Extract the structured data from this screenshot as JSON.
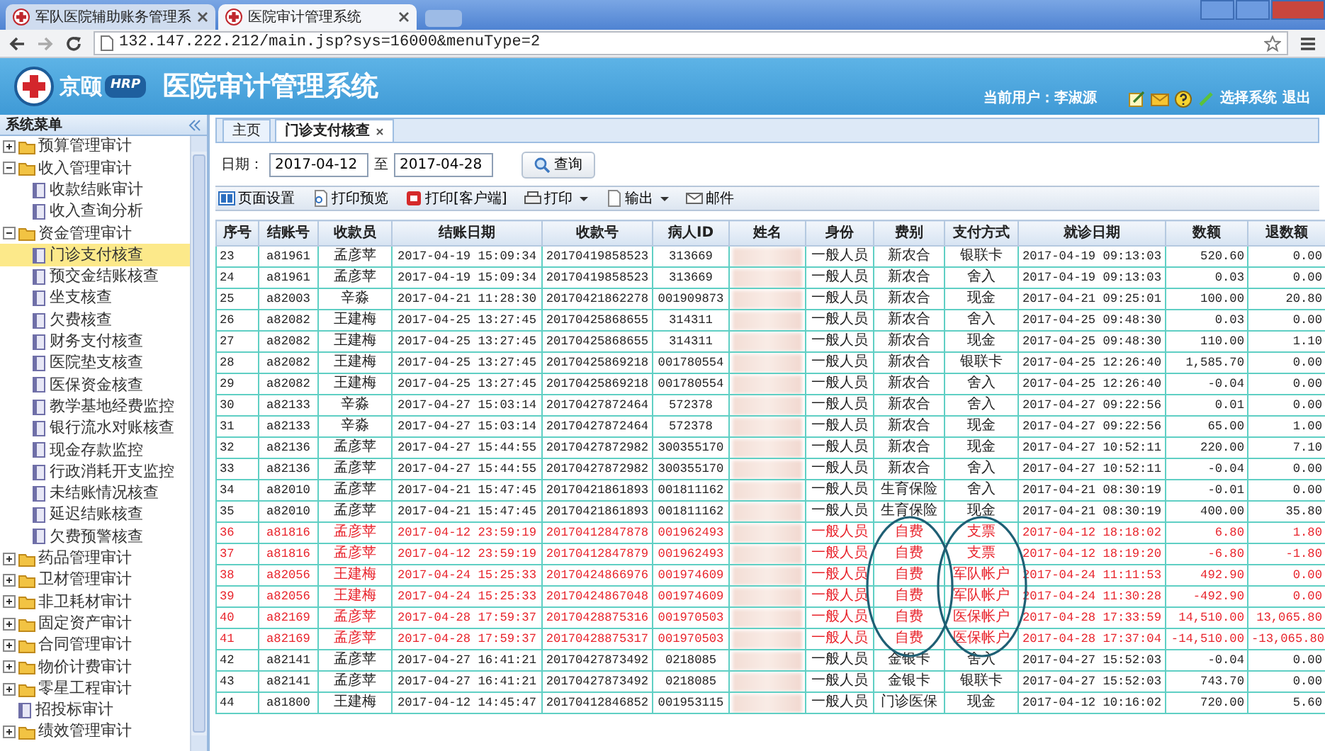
{
  "browser": {
    "tabs": [
      {
        "title": "军队医院辅助账务管理系",
        "selected": false
      },
      {
        "title": "医院审计管理系统",
        "selected": true
      }
    ],
    "url": "132.147.222.212/main.jsp?sys=16000&menuType=2"
  },
  "header": {
    "brand": "京颐",
    "brand_badge": "HRP",
    "title": "医院审计管理系统",
    "user_label": "当前用户：",
    "user_name": "李淑源",
    "links": [
      "选择系统",
      "退出"
    ]
  },
  "sidebar": {
    "title": "系统菜单",
    "items": [
      {
        "kind": "group",
        "label": "预算管理审计",
        "expanded": false
      },
      {
        "kind": "group",
        "label": "收入管理审计",
        "expanded": true,
        "children": [
          {
            "label": "收款结账审计",
            "selected": false
          },
          {
            "label": "收入查询分析",
            "selected": false
          }
        ]
      },
      {
        "kind": "group",
        "label": "资金管理审计",
        "expanded": true,
        "children": [
          {
            "label": "门诊支付核查",
            "selected": true
          },
          {
            "label": "预交金结账核查",
            "selected": false
          },
          {
            "label": "坐支核查",
            "selected": false
          },
          {
            "label": "欠费核查",
            "selected": false
          },
          {
            "label": "财务支付核查",
            "selected": false
          },
          {
            "label": "医院垫支核查",
            "selected": false
          },
          {
            "label": "医保资金核查",
            "selected": false
          },
          {
            "label": "教学基地经费监控",
            "selected": false
          },
          {
            "label": "银行流水对账核查",
            "selected": false
          },
          {
            "label": "现金存款监控",
            "selected": false
          },
          {
            "label": "行政消耗开支监控",
            "selected": false
          },
          {
            "label": "未结账情况核查",
            "selected": false
          },
          {
            "label": "延迟结账核查",
            "selected": false
          },
          {
            "label": "欠费预警核查",
            "selected": false
          }
        ]
      },
      {
        "kind": "group",
        "label": "药品管理审计",
        "expanded": false
      },
      {
        "kind": "group",
        "label": "卫材管理审计",
        "expanded": false
      },
      {
        "kind": "group",
        "label": "非卫耗材审计",
        "expanded": false
      },
      {
        "kind": "group",
        "label": "固定资产审计",
        "expanded": false
      },
      {
        "kind": "group",
        "label": "合同管理审计",
        "expanded": false
      },
      {
        "kind": "group",
        "label": "物价计费审计",
        "expanded": false
      },
      {
        "kind": "group",
        "label": "零星工程审计",
        "expanded": false
      },
      {
        "kind": "leaf",
        "label": "招投标审计",
        "selected": false
      },
      {
        "kind": "group",
        "label": "绩效管理审计",
        "expanded": false
      }
    ]
  },
  "tabs": [
    {
      "label": "主页",
      "selected": false,
      "closable": false
    },
    {
      "label": "门诊支付核查",
      "selected": true,
      "closable": true
    }
  ],
  "filter": {
    "label": "日期：",
    "from": "2017-04-12",
    "separator": "至",
    "to": "2017-04-28",
    "button": "查询"
  },
  "toolbar": [
    {
      "kind": "page-setup",
      "label": "页面设置",
      "dropdown": false
    },
    {
      "kind": "preview",
      "label": "打印预览",
      "dropdown": false
    },
    {
      "kind": "client-print",
      "label": "打印[客户端]",
      "dropdown": false
    },
    {
      "kind": "print",
      "label": "打印",
      "dropdown": true
    },
    {
      "kind": "export",
      "label": "输出",
      "dropdown": true
    },
    {
      "kind": "mail",
      "label": "邮件",
      "dropdown": false
    }
  ],
  "table": {
    "columns": [
      {
        "label": "序号",
        "kind": "text"
      },
      {
        "label": "结账号",
        "kind": "text"
      },
      {
        "label": "收款员",
        "kind": "text"
      },
      {
        "label": "结账日期",
        "kind": "text"
      },
      {
        "label": "收款号",
        "kind": "text"
      },
      {
        "label": "病人ID",
        "kind": "text"
      },
      {
        "label": "姓名",
        "kind": "blurred"
      },
      {
        "label": "身份",
        "kind": "text"
      },
      {
        "label": "费别",
        "kind": "text"
      },
      {
        "label": "支付方式",
        "kind": "text"
      },
      {
        "label": "就诊日期",
        "kind": "text"
      },
      {
        "label": "数额",
        "kind": "text"
      },
      {
        "label": "退数额",
        "kind": "text"
      }
    ],
    "rows": [
      {
        "cells": [
          "23",
          "a81961",
          "孟彦苹",
          "2017-04-19 15:09:34",
          "20170419858523",
          "313669",
          "",
          "一般人员",
          "新农合",
          "银联卡",
          "2017-04-19 09:13:03",
          "520.60",
          "0.00"
        ],
        "highlighted": false,
        "circled": false
      },
      {
        "cells": [
          "24",
          "a81961",
          "孟彦苹",
          "2017-04-19 15:09:34",
          "20170419858523",
          "313669",
          "",
          "一般人员",
          "新农合",
          "舍入",
          "2017-04-19 09:13:03",
          "0.03",
          "0.00"
        ],
        "highlighted": false,
        "circled": false
      },
      {
        "cells": [
          "25",
          "a82003",
          "辛淼",
          "2017-04-21 11:28:30",
          "20170421862278",
          "001909873",
          "",
          "一般人员",
          "新农合",
          "现金",
          "2017-04-21 09:25:01",
          "100.00",
          "20.80"
        ],
        "highlighted": false,
        "circled": false
      },
      {
        "cells": [
          "26",
          "a82082",
          "王建梅",
          "2017-04-25 13:27:45",
          "20170425868655",
          "314311",
          "",
          "一般人员",
          "新农合",
          "舍入",
          "2017-04-25 09:48:30",
          "0.03",
          "0.00"
        ],
        "highlighted": false,
        "circled": false
      },
      {
        "cells": [
          "27",
          "a82082",
          "王建梅",
          "2017-04-25 13:27:45",
          "20170425868655",
          "314311",
          "",
          "一般人员",
          "新农合",
          "现金",
          "2017-04-25 09:48:30",
          "110.00",
          "1.10"
        ],
        "highlighted": false,
        "circled": false
      },
      {
        "cells": [
          "28",
          "a82082",
          "王建梅",
          "2017-04-25 13:27:45",
          "20170425869218",
          "001780554",
          "",
          "一般人员",
          "新农合",
          "银联卡",
          "2017-04-25 12:26:40",
          "1,585.70",
          "0.00"
        ],
        "highlighted": false,
        "circled": false
      },
      {
        "cells": [
          "29",
          "a82082",
          "王建梅",
          "2017-04-25 13:27:45",
          "20170425869218",
          "001780554",
          "",
          "一般人员",
          "新农合",
          "舍入",
          "2017-04-25 12:26:40",
          "-0.04",
          "0.00"
        ],
        "highlighted": false,
        "circled": false
      },
      {
        "cells": [
          "30",
          "a82133",
          "辛淼",
          "2017-04-27 15:03:14",
          "20170427872464",
          "572378",
          "",
          "一般人员",
          "新农合",
          "舍入",
          "2017-04-27 09:22:56",
          "0.01",
          "0.00"
        ],
        "highlighted": false,
        "circled": false
      },
      {
        "cells": [
          "31",
          "a82133",
          "辛淼",
          "2017-04-27 15:03:14",
          "20170427872464",
          "572378",
          "",
          "一般人员",
          "新农合",
          "现金",
          "2017-04-27 09:22:56",
          "65.00",
          "1.00"
        ],
        "highlighted": false,
        "circled": false
      },
      {
        "cells": [
          "32",
          "a82136",
          "孟彦苹",
          "2017-04-27 15:44:55",
          "20170427872982",
          "300355170",
          "",
          "一般人员",
          "新农合",
          "现金",
          "2017-04-27 10:52:11",
          "220.00",
          "7.10"
        ],
        "highlighted": false,
        "circled": false
      },
      {
        "cells": [
          "33",
          "a82136",
          "孟彦苹",
          "2017-04-27 15:44:55",
          "20170427872982",
          "300355170",
          "",
          "一般人员",
          "新农合",
          "舍入",
          "2017-04-27 10:52:11",
          "-0.04",
          "0.00"
        ],
        "highlighted": false,
        "circled": false
      },
      {
        "cells": [
          "34",
          "a82010",
          "孟彦苹",
          "2017-04-21 15:47:45",
          "20170421861893",
          "001811162",
          "",
          "一般人员",
          "生育保险",
          "舍入",
          "2017-04-21 08:30:19",
          "-0.01",
          "0.00"
        ],
        "highlighted": false,
        "circled": false
      },
      {
        "cells": [
          "35",
          "a82010",
          "孟彦苹",
          "2017-04-21 15:47:45",
          "20170421861893",
          "001811162",
          "",
          "一般人员",
          "生育保险",
          "现金",
          "2017-04-21 08:30:19",
          "400.00",
          "35.80"
        ],
        "highlighted": false,
        "circled": false
      },
      {
        "cells": [
          "36",
          "a81816",
          "孟彦苹",
          "2017-04-12 23:59:19",
          "20170412847878",
          "001962493",
          "",
          "一般人员",
          "自费",
          "支票",
          "2017-04-12 18:18:02",
          "6.80",
          "1.80"
        ],
        "highlighted": true,
        "circled": true
      },
      {
        "cells": [
          "37",
          "a81816",
          "孟彦苹",
          "2017-04-12 23:59:19",
          "20170412847879",
          "001962493",
          "",
          "一般人员",
          "自费",
          "支票",
          "2017-04-12 18:19:20",
          "-6.80",
          "-1.80"
        ],
        "highlighted": true,
        "circled": true
      },
      {
        "cells": [
          "38",
          "a82056",
          "王建梅",
          "2017-04-24 15:25:33",
          "20170424866976",
          "001974609",
          "",
          "一般人员",
          "自费",
          "军队帐户",
          "2017-04-24 11:11:53",
          "492.90",
          "0.00"
        ],
        "highlighted": true,
        "circled": true
      },
      {
        "cells": [
          "39",
          "a82056",
          "王建梅",
          "2017-04-24 15:25:33",
          "20170424867048",
          "001974609",
          "",
          "一般人员",
          "自费",
          "军队帐户",
          "2017-04-24 11:30:28",
          "-492.90",
          "0.00"
        ],
        "highlighted": true,
        "circled": true
      },
      {
        "cells": [
          "40",
          "a82169",
          "孟彦苹",
          "2017-04-28 17:59:37",
          "20170428875316",
          "001970503",
          "",
          "一般人员",
          "自费",
          "医保帐户",
          "2017-04-28 17:33:59",
          "14,510.00",
          "13,065.80"
        ],
        "highlighted": true,
        "circled": true
      },
      {
        "cells": [
          "41",
          "a82169",
          "孟彦苹",
          "2017-04-28 17:59:37",
          "20170428875317",
          "001970503",
          "",
          "一般人员",
          "自费",
          "医保帐户",
          "2017-04-28 17:37:04",
          "-14,510.00",
          "-13,065.80"
        ],
        "highlighted": true,
        "circled": true
      },
      {
        "cells": [
          "42",
          "a82141",
          "孟彦苹",
          "2017-04-27 16:41:21",
          "20170427873492",
          "0218085",
          "",
          "一般人员",
          "金银卡",
          "舍入",
          "2017-04-27 15:52:03",
          "-0.04",
          "0.00"
        ],
        "highlighted": false,
        "circled": false
      },
      {
        "cells": [
          "43",
          "a82141",
          "孟彦苹",
          "2017-04-27 16:41:21",
          "20170427873492",
          "0218085",
          "",
          "一般人员",
          "金银卡",
          "银联卡",
          "2017-04-27 15:52:03",
          "743.70",
          "0.00"
        ],
        "highlighted": false,
        "circled": false
      },
      {
        "cells": [
          "44",
          "a81800",
          "王建梅",
          "2017-04-12 14:45:47",
          "20170412846852",
          "001953115",
          "",
          "一般人员",
          "门诊医保",
          "现金",
          "2017-04-12 10:16:02",
          "720.00",
          "5.60"
        ],
        "highlighted": false,
        "circled": false
      }
    ]
  }
}
